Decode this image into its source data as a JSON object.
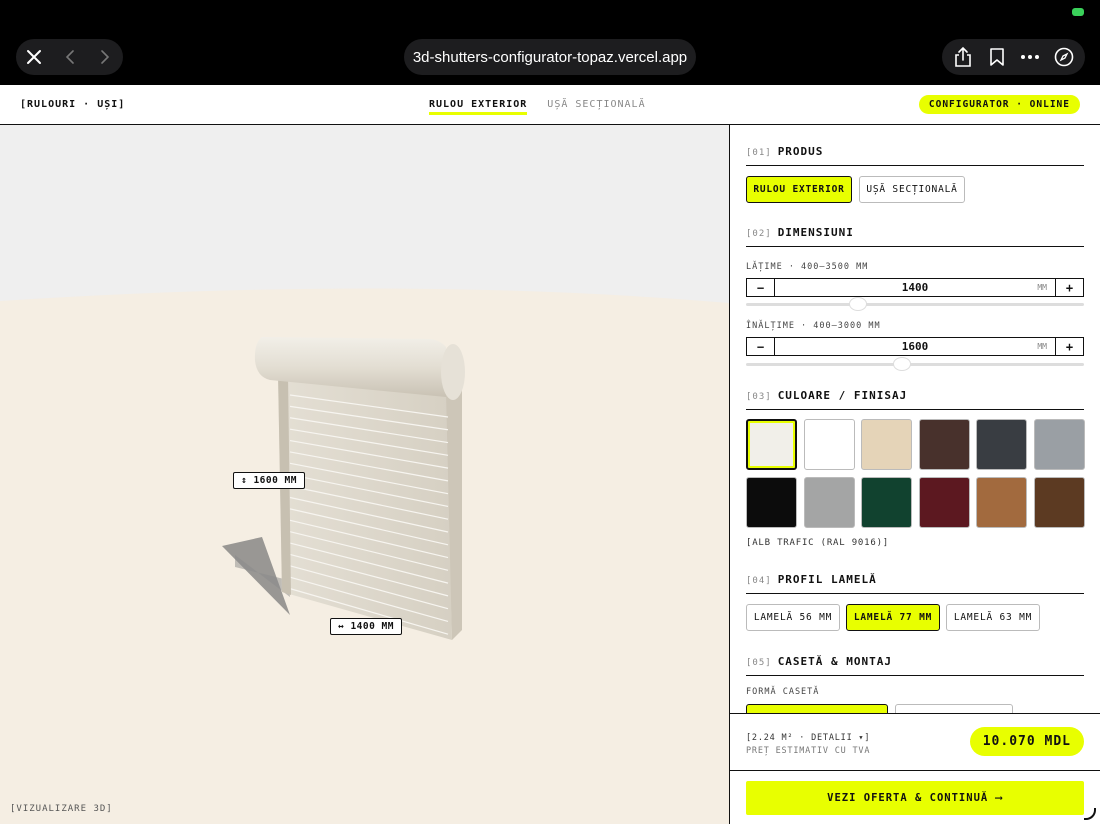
{
  "browser": {
    "url": "3d-shutters-configurator-topaz.vercel.app",
    "icons": [
      "close-icon",
      "back-icon",
      "forward-icon",
      "share-icon",
      "bookmark-icon",
      "more-icon",
      "compass-icon"
    ]
  },
  "header": {
    "brand": "[RULOURI · UȘI]",
    "tabs": [
      {
        "label": "RULOU EXTERIOR",
        "active": true
      },
      {
        "label": "UȘĂ SECȚIONALĂ",
        "active": false
      }
    ],
    "status": "CONFIGURATOR · ONLINE"
  },
  "viewport": {
    "height_label": "↕ 1600 MM",
    "width_label": "↔ 1400 MM",
    "view_label": "[VIZUALIZARE 3D]"
  },
  "sections": {
    "product": {
      "num": "[01]",
      "title": "PRODUS",
      "options": [
        "RULOU EXTERIOR",
        "UȘĂ SECȚIONALĂ"
      ],
      "selected": 0
    },
    "dimensions": {
      "num": "[02]",
      "title": "DIMENSIUNI",
      "width_label": "LĂȚIME · 400–3500 MM",
      "width_value": "1400",
      "height_label": "ÎNĂLȚIME · 400–3000 MM",
      "height_value": "1600",
      "unit": "MM",
      "minus": "−",
      "plus": "+"
    },
    "color": {
      "num": "[03]",
      "title": "CULOARE / FINISAJ",
      "swatches": [
        "#f1efe9",
        "#ffffff",
        "#e5d4b8",
        "#48312c",
        "#393d42",
        "#9a9fa4",
        "#0c0c0c",
        "#a4a5a5",
        "#11422f",
        "#5c1820",
        "#a26a3e",
        "#5c3a22"
      ],
      "selected": 0,
      "selected_name": "[ALB TRAFIC (RAL 9016)]"
    },
    "profile": {
      "num": "[04]",
      "title": "PROFIL LAMELĂ",
      "options": [
        "LAMELĂ 56 MM",
        "LAMELĂ 77 MM",
        "LAMELĂ 63 MM"
      ],
      "selected": 1
    },
    "box": {
      "num": "[05]",
      "title": "CASETĂ & MONTAJ",
      "box_shape_label": "FORMĂ CASETĂ"
    }
  },
  "footer": {
    "info": "[2.24 M² · DETALII ▾]",
    "sub": "PREȚ ESTIMATIV CU TVA",
    "price": "10.070 MDL",
    "cta": "VEZI OFERTA & CONTINUĂ ⟶"
  }
}
